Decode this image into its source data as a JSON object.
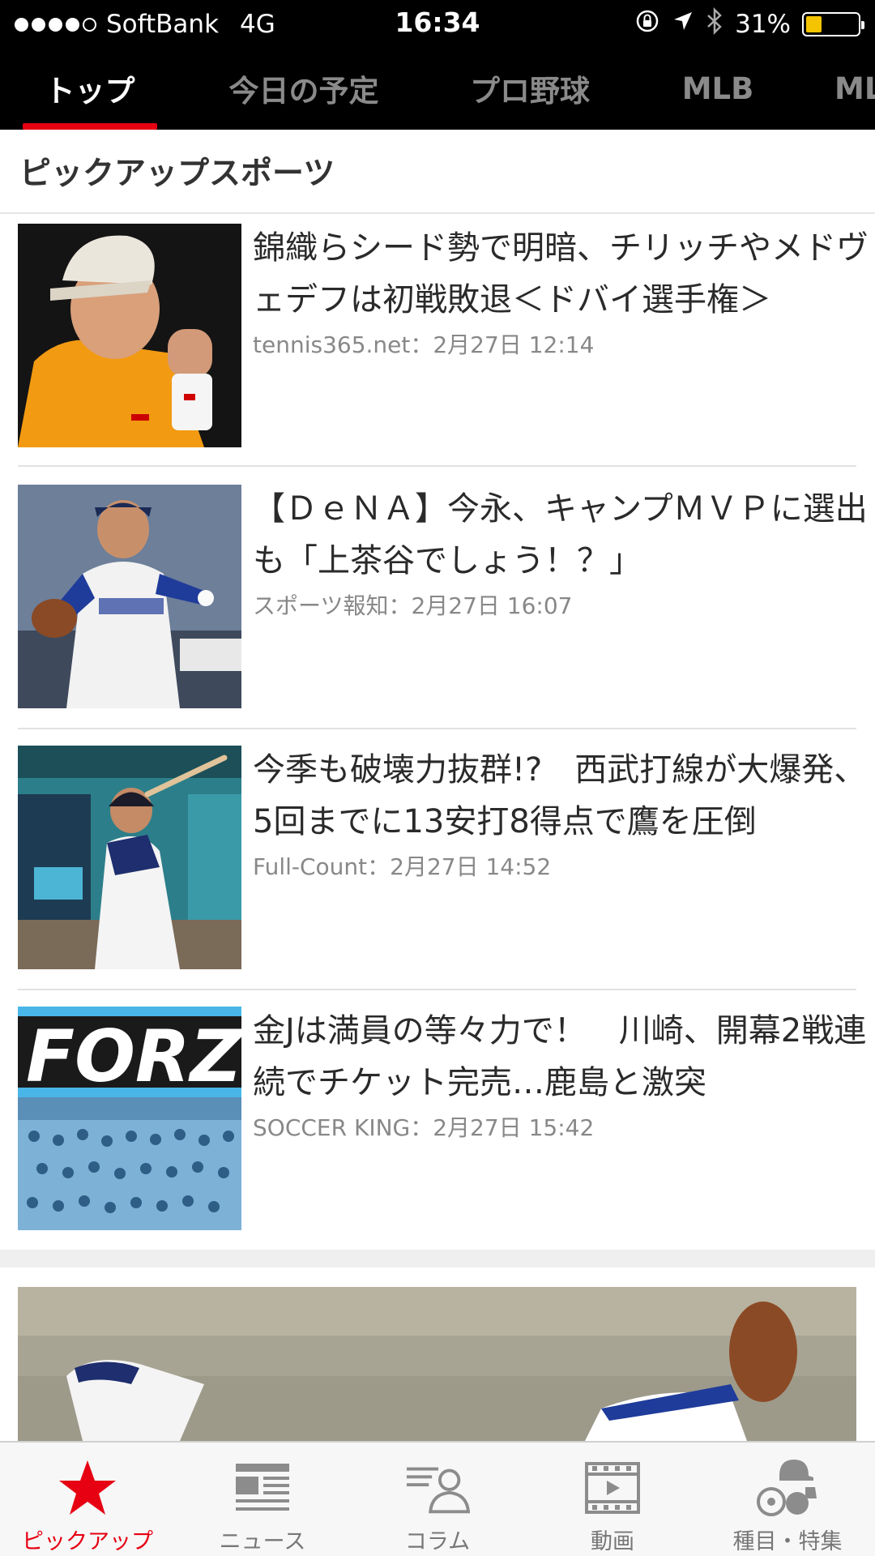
{
  "status_bar": {
    "carrier": "SoftBank",
    "network": "4G",
    "time": "16:34",
    "battery": "31%",
    "battery_level": 0.31,
    "signal_bars": 4,
    "icons": [
      "rotation-lock-icon",
      "location-arrow-icon",
      "bluetooth-icon",
      "battery-icon"
    ]
  },
  "top_tabs": [
    {
      "label": "トップ",
      "active": true
    },
    {
      "label": "今日の予定",
      "active": false
    },
    {
      "label": "プロ野球",
      "active": false
    },
    {
      "label": "MLB",
      "active": false
    },
    {
      "label": "MLB",
      "active": false
    }
  ],
  "section": {
    "title": "ピックアップスポーツ"
  },
  "articles": [
    {
      "headline": "錦織らシード勢で明暗、チリッチやメドヴェデフは初戦敗退＜ドバイ選手権＞",
      "meta": "tennis365.net：2月27日 12:14",
      "thumb": "tennis-player-photo"
    },
    {
      "headline": "【ＤｅＮＡ】今永、キャンプＭＶＰに選出も「上茶谷でしょう！？」",
      "meta": "スポーツ報知：2月27日 16:07",
      "thumb": "baseball-pitcher-photo"
    },
    {
      "headline": "今季も破壊力抜群!?　西武打線が大爆発、5回までに13安打8得点で鷹を圧倒",
      "meta": "Full-Count：2月27日 14:52",
      "thumb": "baseball-batter-photo"
    },
    {
      "headline": "金Jは満員の等々力で！　川崎、開幕2戦連続でチケット完売…鹿島と激突",
      "meta": "SOCCER KING：2月27日 15:42",
      "thumb": "soccer-supporters-photo"
    }
  ],
  "bottom_nav": [
    {
      "label": "ピックアップ",
      "icon": "star-icon",
      "active": true
    },
    {
      "label": "ニュース",
      "icon": "newspaper-icon",
      "active": false
    },
    {
      "label": "コラム",
      "icon": "column-icon",
      "active": false
    },
    {
      "label": "動画",
      "icon": "film-icon",
      "active": false
    },
    {
      "label": "種目・特集",
      "icon": "sports-balls-icon",
      "active": false
    }
  ],
  "colors": {
    "accent": "#e60012",
    "tab_bar": "#000000",
    "battery": "#f5c400"
  }
}
